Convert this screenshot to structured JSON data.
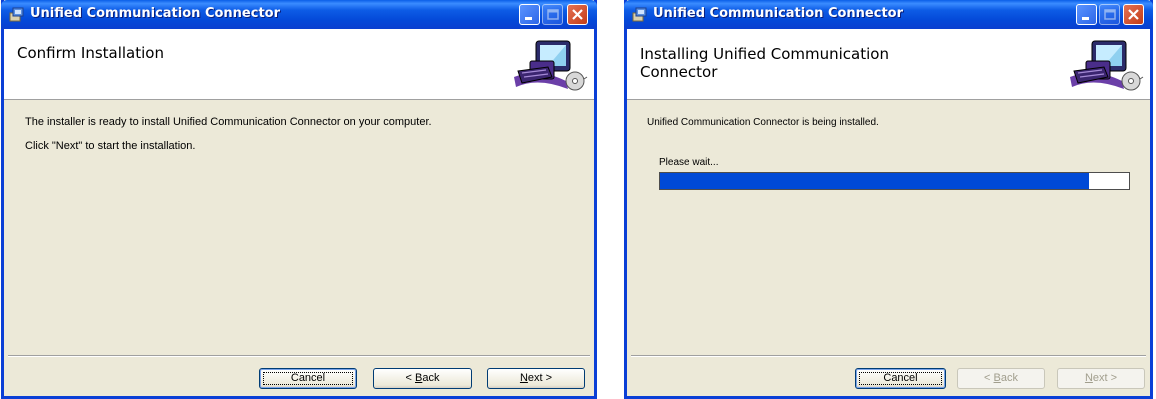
{
  "windows": [
    {
      "title": "Unified Communication Connector",
      "banner_title": "Confirm Installation",
      "body_lines": [
        "The installer is ready to install Unified Communication Connector on your computer.",
        "Click \"Next\" to start the installation."
      ],
      "buttons": {
        "cancel": "Cancel",
        "back_access": "B",
        "back_rest": "ack",
        "back_prefix": "< ",
        "next_access": "N",
        "next_rest": "ext >"
      },
      "minimize_enabled": true,
      "maximize_enabled": false
    },
    {
      "title": "Unified Communication Connector",
      "banner_title_line1": "Installing Unified Communication",
      "banner_title_line2": "Connector",
      "status": "Unified Communication Connector is being installed.",
      "wait_label": "Please wait...",
      "progress": 0.914,
      "buttons": {
        "cancel": "Cancel",
        "back_access": "B",
        "back_rest": "ack",
        "back_prefix": "< ",
        "next_access": "N",
        "next_rest": "ext >"
      },
      "back_enabled": false,
      "next_enabled": false
    }
  ],
  "colors": {
    "titlebar": "#0a5ee8",
    "progress_fill": "#0049d6",
    "window_face": "#ece9d8"
  },
  "icons": [
    "installer-app-icon",
    "minimize-icon",
    "maximize-icon",
    "close-icon",
    "computer-install-graphic"
  ]
}
